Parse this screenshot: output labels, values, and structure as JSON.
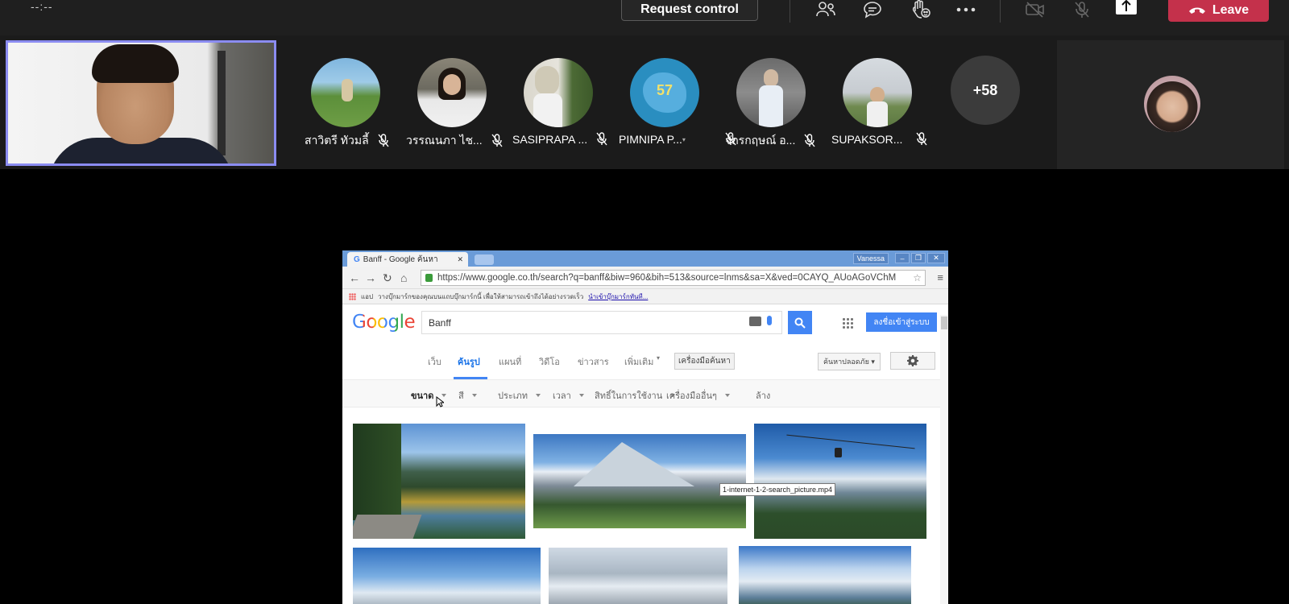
{
  "meeting": {
    "timer": "--:--",
    "request_control_label": "Request control",
    "leave_label": "Leave",
    "overflow_count": "+58"
  },
  "participants": [
    {
      "name": "สาวิตรี ทัวมลี้",
      "muted": true
    },
    {
      "name": "วรรณนภา ไช...",
      "muted": true
    },
    {
      "name": "SASIPRAPA ...",
      "muted": true
    },
    {
      "name": "PIMNIPA P...",
      "muted": true,
      "initials": "57",
      "dropdown": true
    },
    {
      "name": "จักรกฤษณ์ อ...",
      "muted": true
    },
    {
      "name": "SUPAKSOR...",
      "muted": true
    }
  ],
  "browser": {
    "tab_title": "Banff - Google ค้นหา",
    "window_user": "Vanessa",
    "url": "https://www.google.co.th/search?q=banff&biw=960&bih=513&source=lnms&sa=X&ved=0CAYQ_AUoAGoVChM",
    "bookmark_apps": "แอป",
    "bookmark_text": "วางบุ๊กมาร์กของคุณบนแถบบุ๊กมาร์กนี้ เพื่อให้สามารถเข้าถึงได้อย่างรวดเร็ว",
    "bookmark_link": "นำเข้าบุ๊กมาร์กทันที..."
  },
  "google": {
    "logo": "Google",
    "query": "Banff",
    "signin_label": "ลงชื่อเข้าสู่ระบบ",
    "tabs": [
      "เว็บ",
      "ค้นรูป",
      "แผนที่",
      "วิดีโอ",
      "ข่าวสาร",
      "เพิ่มเติม"
    ],
    "search_tools": "เครื่องมือค้นหา",
    "safe_search": "ค้นหาปลอดภัย",
    "filters": [
      "ขนาด",
      "สี",
      "ประเภท",
      "เวลา",
      "สิทธิ์ในการใช้งาน",
      "เครื่องมืออื่นๆ",
      "ล้าง"
    ],
    "tooltip": "1-internet-1-2-search_picture.mp4"
  },
  "colors": {
    "accent": "#8b8cf1",
    "leave": "#c4314b",
    "google_blue": "#4285f4"
  }
}
